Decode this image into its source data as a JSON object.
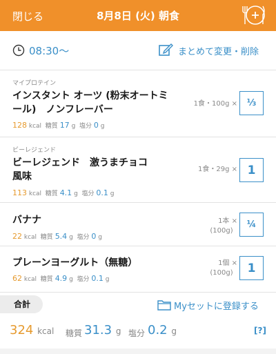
{
  "header": {
    "close_label": "閉じる",
    "title": "8月8日 (火) 朝食",
    "meal_icon": "plate-fork-knife-icon",
    "bg_color": "#f0902a"
  },
  "time_row": {
    "time": "08:30～",
    "bulk_edit_label": "まとめて変更・削除"
  },
  "items": [
    {
      "brand": "マイプロテイン",
      "name_line1": "インスタント オーツ (粉末オートミ",
      "name_line2": "ール)　ノンフレーバー",
      "kcal": "128",
      "kcal_unit": "kcal",
      "carb_label": "糖質",
      "carb": "17",
      "carb_unit": "g",
      "salt_label": "塩分",
      "salt": "0",
      "salt_unit": "g",
      "amount_line1": "1食・100g ×",
      "amount_line2": "",
      "qty": "⅓"
    },
    {
      "brand": "ビーレジェンド",
      "name_line1": "ビーレジェンド　激うまチョコ",
      "name_line2": "風味",
      "kcal": "113",
      "kcal_unit": "kcal",
      "carb_label": "糖質",
      "carb": "4.1",
      "carb_unit": "g",
      "salt_label": "塩分",
      "salt": "0.1",
      "salt_unit": "g",
      "amount_line1": "1食・29g ×",
      "amount_line2": "",
      "qty": "1"
    },
    {
      "brand": "",
      "name_line1": "バナナ",
      "name_line2": "",
      "kcal": "22",
      "kcal_unit": "kcal",
      "carb_label": "糖質",
      "carb": "5.4",
      "carb_unit": "g",
      "salt_label": "塩分",
      "salt": "0",
      "salt_unit": "g",
      "amount_line1": "1本",
      "amount_line2": "(100g)",
      "qty": "¼"
    },
    {
      "brand": "",
      "name_line1": "プレーンヨーグルト（無糖）",
      "name_line2": "",
      "kcal": "62",
      "kcal_unit": "kcal",
      "carb_label": "糖質",
      "carb": "4.9",
      "carb_unit": "g",
      "salt_label": "塩分",
      "salt": "0.1",
      "salt_unit": "g",
      "amount_line1": "1個",
      "amount_line2": "(100g)",
      "qty": "1"
    }
  ],
  "total": {
    "label": "合計",
    "myset_label": "Myセットに登録する",
    "kcal": "324",
    "kcal_unit": "kcal",
    "carb_label": "糖質",
    "carb": "31.3",
    "carb_unit": "g",
    "salt_label": "塩分",
    "salt": "0.2",
    "salt_unit": "g",
    "help": "[?]"
  },
  "colors": {
    "accent_orange": "#f0902a",
    "link_blue": "#3a8fc8",
    "kcal_orange": "#e69a2e"
  }
}
